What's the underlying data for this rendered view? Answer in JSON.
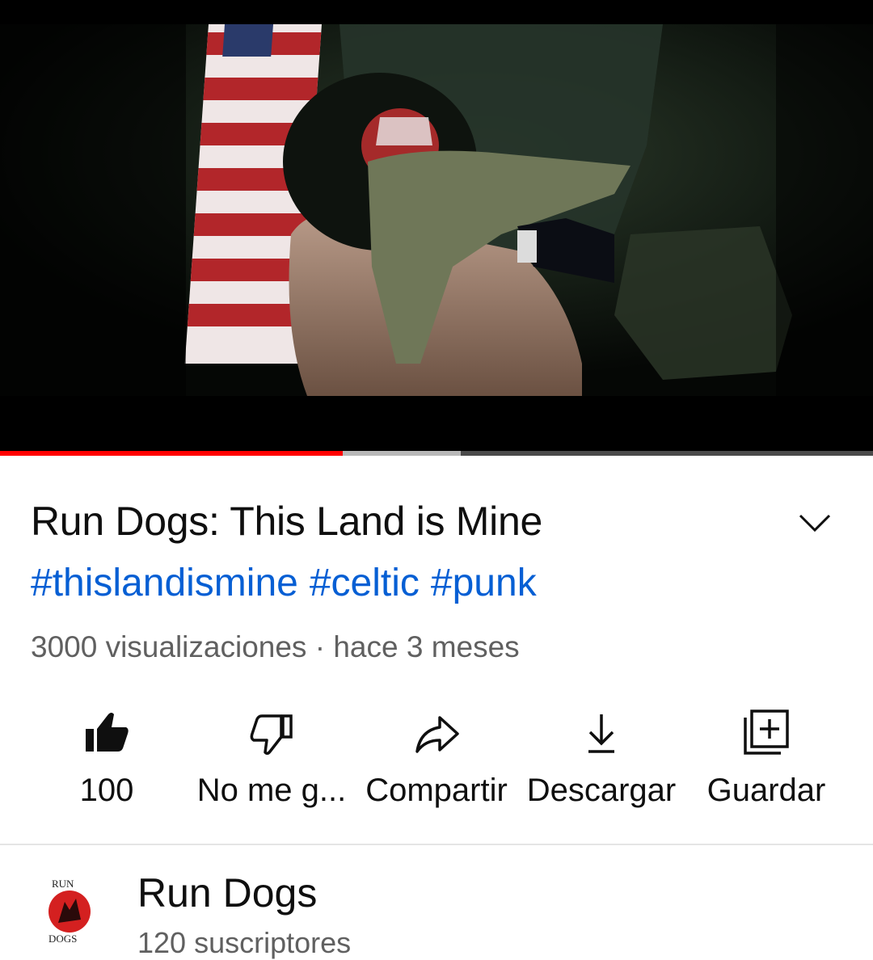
{
  "player": {
    "progress_played": 0.393,
    "progress_buffered": 0.528
  },
  "video": {
    "title": "Run Dogs: This Land is Mine",
    "hashtags": [
      "#thislandismine",
      "#celtic",
      "#punk"
    ],
    "views": "3000 visualizaciones",
    "separator": " · ",
    "age": "hace 3 meses"
  },
  "actions": {
    "like": {
      "label": "100",
      "icon": "thumbs-up-filled-icon"
    },
    "dislike": {
      "label": "No me g...",
      "icon": "thumbs-down-icon"
    },
    "share": {
      "label": "Compartir",
      "icon": "share-arrow-icon"
    },
    "download": {
      "label": "Descargar",
      "icon": "download-icon"
    },
    "save": {
      "label": "Guardar",
      "icon": "add-to-playlist-icon"
    }
  },
  "channel": {
    "name": "Run Dogs",
    "subscribers": "120 suscriptores",
    "logo_text_top": "RUN",
    "logo_text_bottom": "DOGS"
  },
  "colors": {
    "accent": "#ff0000",
    "link": "#065fd4",
    "secondary_text": "#606060"
  }
}
